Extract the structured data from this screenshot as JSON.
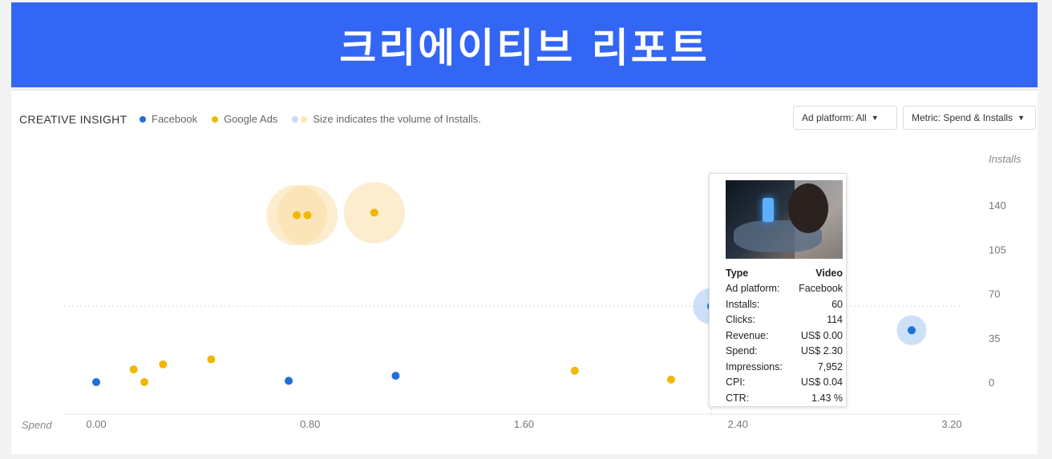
{
  "banner": {
    "title": "크리에이티브 리포트"
  },
  "header": {
    "insight_title": "CREATIVE INSIGHT",
    "legend": [
      {
        "label": "Facebook",
        "color": "#1f6fd8"
      },
      {
        "label": "Google Ads",
        "color": "#f2b705"
      },
      {
        "label": "Size indicates the volume of Installs."
      }
    ],
    "ad_platform_dropdown": "Ad platform: All",
    "metric_dropdown": "Metric: Spend & Installs"
  },
  "chart_data": {
    "type": "scatter",
    "xlabel": "Spend",
    "ylabel": "Installs",
    "x_ticks": [
      "0.00",
      "0.80",
      "1.60",
      "2.40",
      "3.20"
    ],
    "y_ticks": [
      "0",
      "35",
      "70",
      "105",
      "140"
    ],
    "xlim": [
      0,
      3.2
    ],
    "ylim": [
      0,
      140
    ],
    "series": [
      {
        "name": "Facebook",
        "color": "#1f6fd8",
        "points": [
          {
            "x": 0.0,
            "y": 0
          },
          {
            "x": 0.72,
            "y": 1
          },
          {
            "x": 1.12,
            "y": 5
          },
          {
            "x": 2.3,
            "y": 60
          },
          {
            "x": 3.05,
            "y": 41
          }
        ]
      },
      {
        "name": "Google Ads",
        "color": "#f2b705",
        "points": [
          {
            "x": 0.14,
            "y": 10
          },
          {
            "x": 0.18,
            "y": 0
          },
          {
            "x": 0.25,
            "y": 14
          },
          {
            "x": 0.43,
            "y": 18
          },
          {
            "x": 0.75,
            "y": 132
          },
          {
            "x": 0.79,
            "y": 132
          },
          {
            "x": 1.04,
            "y": 134
          },
          {
            "x": 1.79,
            "y": 9
          },
          {
            "x": 2.15,
            "y": 2
          }
        ]
      }
    ]
  },
  "tooltip": {
    "rows": [
      {
        "label": "Type",
        "value": "Video"
      },
      {
        "label": "Ad platform:",
        "value": "Facebook"
      },
      {
        "label": "Installs:",
        "value": "60"
      },
      {
        "label": "Clicks:",
        "value": "114"
      },
      {
        "label": "Revenue:",
        "value": "US$ 0.00"
      },
      {
        "label": "Spend:",
        "value": "US$ 2.30"
      },
      {
        "label": "Impressions:",
        "value": "7,952"
      },
      {
        "label": "CPI:",
        "value": "US$ 0.04"
      },
      {
        "label": "CTR:",
        "value": "1.43 %"
      }
    ]
  }
}
